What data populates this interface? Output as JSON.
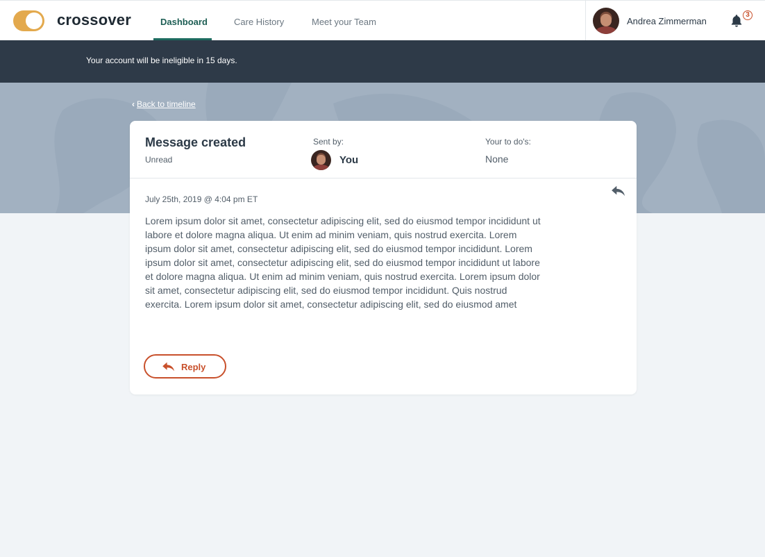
{
  "app": {
    "brand": "crossover",
    "accent_color": "#e3a94d"
  },
  "nav": {
    "tabs": [
      {
        "label": "Dashboard",
        "active": true
      },
      {
        "label": "Care History",
        "active": false
      },
      {
        "label": "Meet your Team",
        "active": false
      }
    ],
    "user": {
      "name": "Andrea Zimmerman"
    },
    "notifications": {
      "count": "3",
      "icon": "bell-icon"
    }
  },
  "banner": {
    "text": "Your account will be ineligible in 15 days."
  },
  "back_link": {
    "label": "Back to timeline"
  },
  "message": {
    "title": "Message created",
    "status": "Unread",
    "sent_by_label": "Sent by:",
    "sent_by": "You",
    "todo_label": "Your to do's:",
    "todo_value": "None",
    "timestamp": "July 25th, 2019 @ 4:04 pm ET",
    "body": "Lorem ipsum dolor sit amet, consectetur adipiscing elit, sed do eiusmod tempor incididunt ut labore et dolore magna aliqua. Ut enim ad minim veniam, quis nostrud exercita. Lorem ipsum dolor sit amet, consectetur adipiscing elit, sed do eiusmod tempor incididunt. Lorem ipsum dolor sit amet, consectetur adipiscing elit, sed do eiusmod tempor incididunt ut labore et dolore magna aliqua. Ut enim ad minim veniam, quis nostrud exercita. Lorem ipsum dolor sit amet, consectetur adipiscing elit, sed do eiusmod tempor incididunt. Quis nostrud exercita. Lorem ipsum dolor sit amet, consectetur adipiscing elit, sed do eiusmod amet",
    "reply_label": "Reply"
  }
}
